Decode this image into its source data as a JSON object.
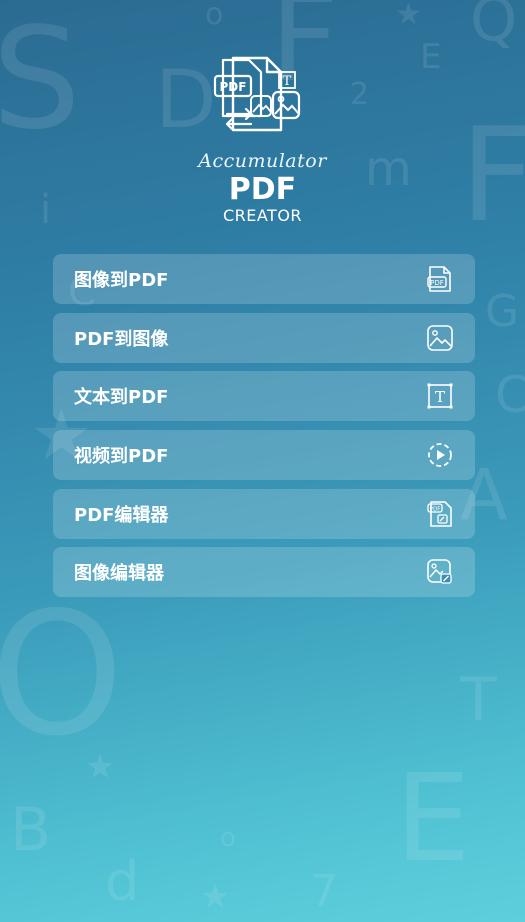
{
  "logo": {
    "script_text": "Accumulator",
    "title": "PDF",
    "subtitle": "CREATOR",
    "badge_text": "PDF",
    "t_glyph": "T"
  },
  "menu": {
    "items": [
      {
        "label": "图像到PDF",
        "icon": "pdf-file-icon"
      },
      {
        "label": "PDF到图像",
        "icon": "image-icon"
      },
      {
        "label": "文本到PDF",
        "icon": "text-frame-icon"
      },
      {
        "label": "视频到PDF",
        "icon": "video-play-icon"
      },
      {
        "label": "PDF编辑器",
        "icon": "pdf-edit-icon"
      },
      {
        "label": "图像编辑器",
        "icon": "image-edit-icon"
      }
    ],
    "pdf_icon_text": "PDF",
    "text_icon_glyph": "T"
  },
  "colors": {
    "bg_top": "#2b6b92",
    "bg_bottom": "#5dd0dc",
    "button_fill": "rgba(255,255,255,0.18)",
    "text": "#ffffff"
  }
}
